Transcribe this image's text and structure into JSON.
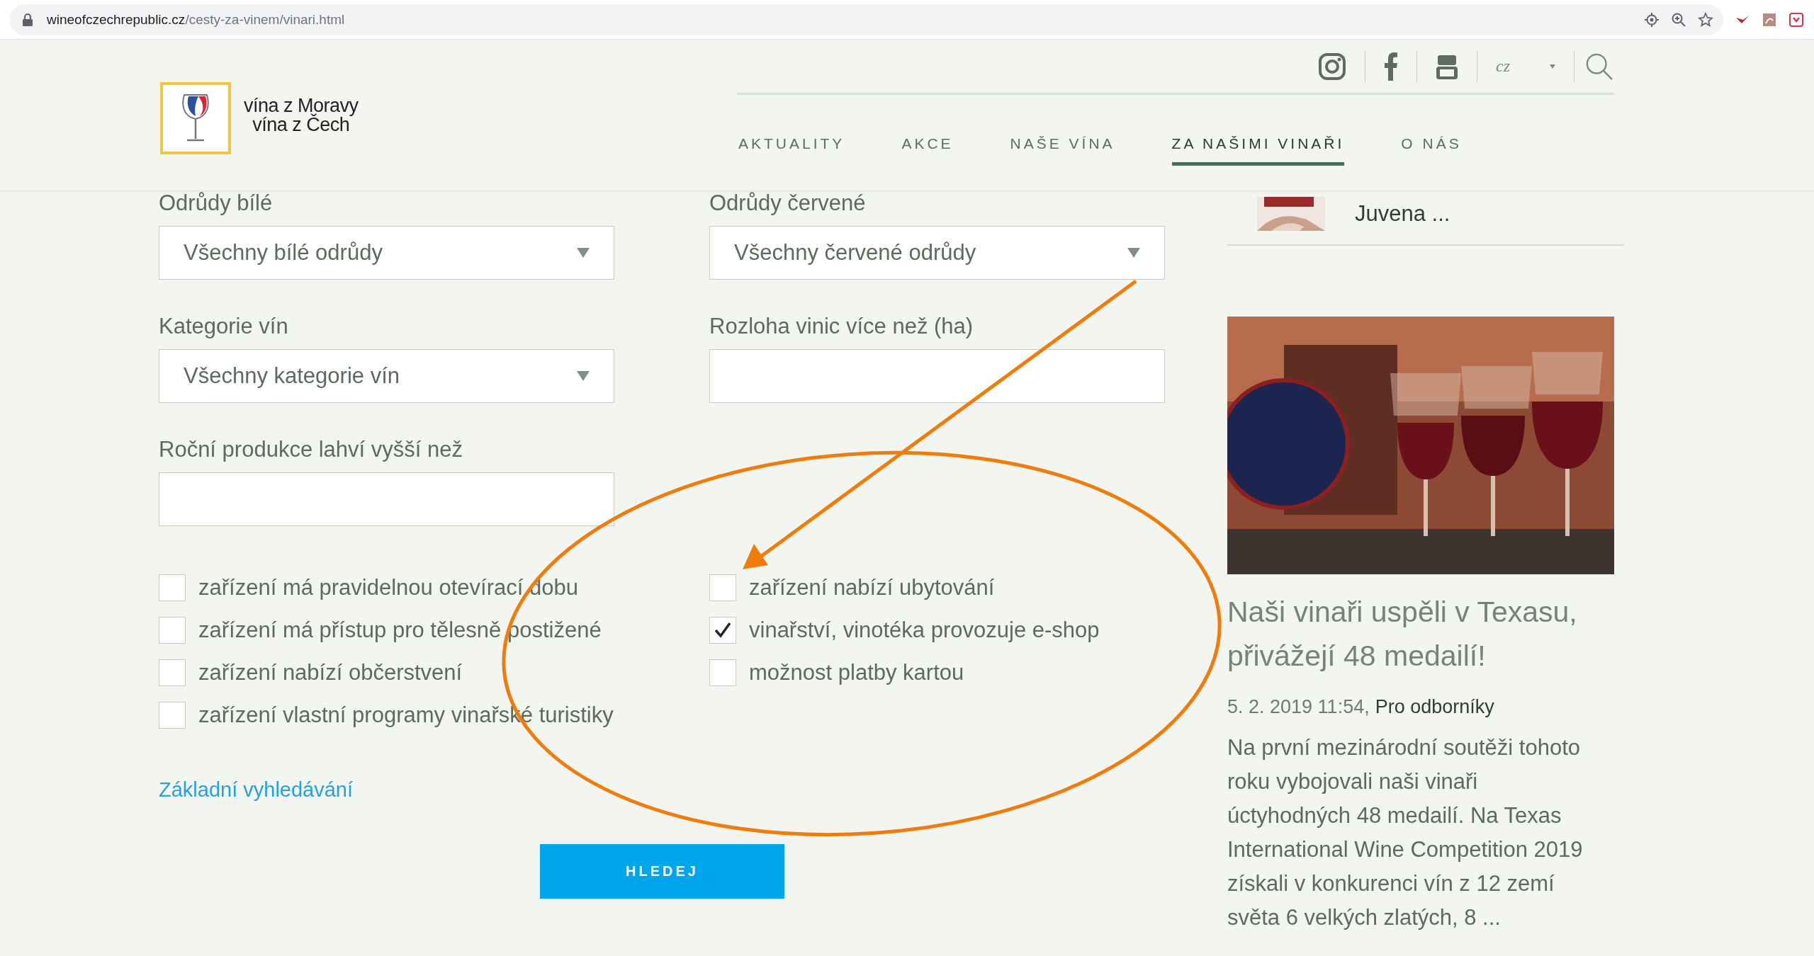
{
  "browser": {
    "url_domain": "wineofczechrepublic.cz",
    "url_path": "/cesty-za-vinem/vinari.html"
  },
  "header": {
    "logo_lines": [
      "vína z Moravy",
      "vína z Čech"
    ],
    "language": "cz",
    "nav": [
      {
        "label": "AKTUALITY",
        "selected": false
      },
      {
        "label": "AKCE",
        "selected": false
      },
      {
        "label": "NAŠE VÍNA",
        "selected": false
      },
      {
        "label": "ZA NAŠIMI VINAŘI",
        "selected": true
      },
      {
        "label": "O NÁS",
        "selected": false
      }
    ]
  },
  "form": {
    "fields": [
      {
        "kind": "select",
        "label": "Odrůdy bílé",
        "value": "Všechny bílé odrůdy"
      },
      {
        "kind": "select",
        "label": "Odrůdy červené",
        "value": "Všechny červené odrůdy"
      },
      {
        "kind": "select",
        "label": "Kategorie vín",
        "value": "Všechny kategorie vín"
      },
      {
        "kind": "input",
        "label": "Rozloha vinic více než (ha)"
      },
      {
        "kind": "input",
        "label": "Roční produkce lahví vyšší než"
      }
    ],
    "checkbox_columns": [
      [
        {
          "label": "zařízení má pravidelnou otevírací dobu",
          "checked": false
        },
        {
          "label": "zařízení má přístup pro tělesně postižené",
          "checked": false
        },
        {
          "label": "zařízení nabízí občerstvení",
          "checked": false
        },
        {
          "label": "zařízení vlastní programy vinařské turistiky",
          "checked": false
        }
      ],
      [
        {
          "label": "zařízení nabízí ubytování",
          "checked": false
        },
        {
          "label": "vinařství, vinotéka provozuje e-shop",
          "checked": true
        },
        {
          "label": "možnost platby kartou",
          "checked": false
        }
      ]
    ],
    "link": "Základní vyhledávání",
    "button": "HLEDEJ"
  },
  "sidebar": {
    "top_item": {
      "title": "Juvena ..."
    },
    "article": {
      "title": "Naši vinaři uspěli v Texasu, přivážejí 48 medailí!",
      "date": "5. 2. 2019 11:54,",
      "category": "Pro odborníky",
      "excerpt": "Na první mezinárodní soutěži tohoto roku vybojovali naši vinaři úctyhodných 48 medailí. Na Texas International Wine Competition 2019 získali v konkurenci vín z 12 zemí světa 6 velkých zlatých, 8 ..."
    }
  }
}
